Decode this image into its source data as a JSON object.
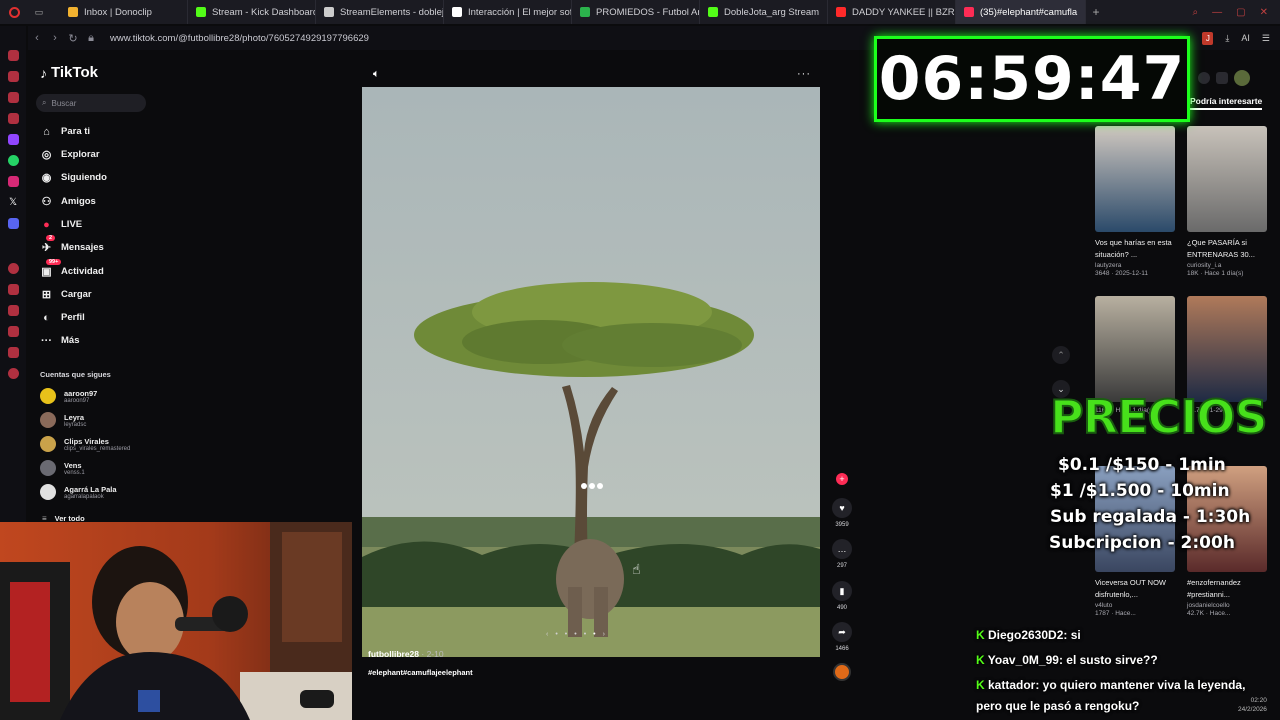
{
  "browser": {
    "tabs": [
      {
        "label": "Inbox | Donoclip",
        "color": "#f2b230"
      },
      {
        "label": "Stream - Kick Dashboard",
        "color": "#53fc18"
      },
      {
        "label": "StreamElements - doblejo",
        "color": "#cccccc"
      },
      {
        "label": "Interacción | El mejor softw",
        "color": "#ffffff"
      },
      {
        "label": "PROMIEDOS - Futbol Argen",
        "color": "#2bb24c"
      },
      {
        "label": "DobleJota_arg Stream",
        "color": "#53fc18"
      },
      {
        "label": "DADDY YANKEE || BZRP M",
        "color": "#ff2a2a"
      },
      {
        "label": "(35)#elephant#camufla",
        "color": "#fe2c55"
      }
    ],
    "add_tab": "+",
    "url": "www.tiktok.com/@futbollibre28/photo/7605274929197796629",
    "ai_label": "AI"
  },
  "tiktok": {
    "logo": "TikTok",
    "search_placeholder": "Buscar",
    "nav": [
      {
        "label": "Para ti",
        "icon": "home-icon",
        "glyph": "⌂"
      },
      {
        "label": "Explorar",
        "icon": "compass-icon",
        "glyph": "◎"
      },
      {
        "label": "Siguiendo",
        "icon": "following-icon",
        "glyph": "◉"
      },
      {
        "label": "Amigos",
        "icon": "friends-icon",
        "glyph": "⚇"
      },
      {
        "label": "LIVE",
        "icon": "live-icon",
        "glyph": "●"
      },
      {
        "label": "Mensajes",
        "icon": "messages-icon",
        "glyph": "✈"
      },
      {
        "label": "Actividad",
        "icon": "activity-icon",
        "glyph": "▣"
      },
      {
        "label": "Cargar",
        "icon": "upload-icon",
        "glyph": "⊞"
      },
      {
        "label": "Perfil",
        "icon": "profile-icon",
        "glyph": "◐"
      },
      {
        "label": "Más",
        "icon": "more-icon",
        "glyph": "···"
      }
    ],
    "messages_badge": "2",
    "activity_badge": "99+",
    "following_title": "Cuentas que sigues",
    "accounts": [
      {
        "name": "aaroon97",
        "handle": "aaroon97",
        "color": "#e8c21a"
      },
      {
        "name": "Leyra",
        "handle": "leyradsc",
        "color": "#8a6a5a"
      },
      {
        "name": "Clips Virales",
        "handle": "clips_virales_remastered",
        "color": "#c9a24a"
      },
      {
        "name": "Vens",
        "handle": "venss.1",
        "color": "#6a6a72"
      },
      {
        "name": "Agarrá La Pala",
        "handle": "agarralapalaok",
        "color": "#e0e0e0"
      }
    ],
    "see_all": "Ver todo",
    "post": {
      "user": "futbollibre28",
      "date": "· 2-10",
      "tags": "#elephant#camuflajeelephant",
      "likes": "3959",
      "comments": "297",
      "saves": "490",
      "shares": "1466"
    },
    "right_tab": "Podría interesarte",
    "cards": [
      {
        "title": "Vos que harías en esta situación? ...",
        "user": "lautyzera",
        "meta": "3648 · 2025-12-11",
        "bg1": "#2b4a6a",
        "bg2": "#d0c8c0"
      },
      {
        "title": "¿Que PASARÍA si ENTRENARAS 30...",
        "user": "curiosity_i.a",
        "meta": "18K · Hace 1 día(s)",
        "bg1": "#6a6a6a",
        "bg2": "#c8c2ba"
      },
      {
        "title": "",
        "user": "",
        "meta": "116K · Hace 1 día(s)",
        "bg1": "#3a3a3a",
        "bg2": "#b8b0a0"
      },
      {
        "title": "",
        "user": "",
        "meta": "22.7K · 1-29",
        "bg1": "#1e2a44",
        "bg2": "#b07a5a"
      },
      {
        "title": "Viceversa OUT NOW disfrutenlo,...",
        "user": "v4luto",
        "meta": "1787 · Hace...",
        "bg1": "#3a4660",
        "bg2": "#8aa0c0"
      },
      {
        "title": "#enzofernandez #prestianni...",
        "user": "josdanielcoello",
        "meta": "42.7K · Hace...",
        "bg1": "#5a2a2a",
        "bg2": "#d0a080"
      }
    ]
  },
  "timer": "06:59:47",
  "overlay": {
    "title": "PRECIOS",
    "prices": [
      "$0.1 /$150 - 1min",
      "$1 /$1.500 - 10min",
      "Sub regalada - 1:30h",
      "Subcripcion - 2:00h"
    ]
  },
  "chat": [
    {
      "user": "Diego2630D2",
      "text": ": si"
    },
    {
      "user": "Yoav_0M_99",
      "text": ": el susto sirve??"
    },
    {
      "user": "kattador",
      "text": ": yo quiero mantener viva la leyenda,"
    },
    {
      "user": "",
      "text": "pero que le pasó a rengoku?"
    }
  ],
  "clock": {
    "time": "02:20",
    "date": "24/2/2026"
  }
}
